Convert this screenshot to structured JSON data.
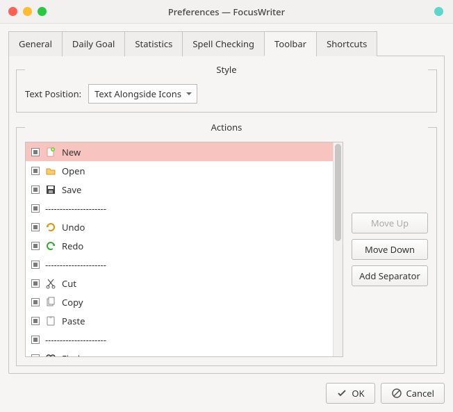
{
  "window": {
    "title": "Preferences — FocusWriter"
  },
  "tabs": [
    "General",
    "Daily Goal",
    "Statistics",
    "Spell Checking",
    "Toolbar",
    "Shortcuts"
  ],
  "activeTab": 4,
  "style": {
    "legend": "Style",
    "label": "Text Position:",
    "value": "Text Alongside Icons"
  },
  "actions": {
    "legend": "Actions",
    "items": [
      {
        "icon": "new-icon",
        "label": "New",
        "checked": true,
        "selected": true
      },
      {
        "icon": "open-icon",
        "label": "Open",
        "checked": true
      },
      {
        "icon": "save-icon",
        "label": "Save",
        "checked": true
      },
      {
        "separator": true,
        "label": "---------------------",
        "checked": true
      },
      {
        "icon": "undo-icon",
        "label": "Undo",
        "checked": true
      },
      {
        "icon": "redo-icon",
        "label": "Redo",
        "checked": true
      },
      {
        "separator": true,
        "label": "---------------------",
        "checked": true
      },
      {
        "icon": "cut-icon",
        "label": "Cut",
        "checked": true
      },
      {
        "icon": "copy-icon",
        "label": "Copy",
        "checked": true
      },
      {
        "icon": "paste-icon",
        "label": "Paste",
        "checked": true
      },
      {
        "separator": true,
        "label": "---------------------",
        "checked": true
      },
      {
        "icon": "find-icon",
        "label": "Find",
        "checked": true
      }
    ],
    "buttons": {
      "moveUp": "Move Up",
      "moveDown": "Move Down",
      "addSeparator": "Add Separator"
    }
  },
  "footer": {
    "ok": "OK",
    "cancel": "Cancel"
  }
}
